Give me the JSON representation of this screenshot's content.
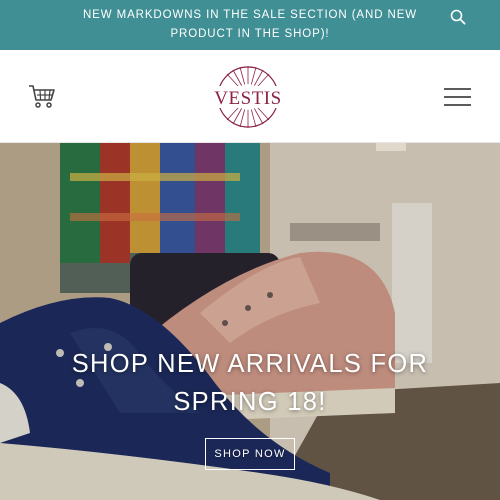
{
  "announcement": {
    "text": "NEW MARKDOWNS IN THE SALE SECTION (AND NEW PRODUCT IN THE SHOP)!",
    "background": "#3f8f95",
    "search_icon": "search-icon"
  },
  "header": {
    "logo_text": "VESTIS",
    "brand_color": "#8b2342",
    "cart_icon": "shopping-cart-icon",
    "menu_icon": "hamburger-menu-icon"
  },
  "hero": {
    "heading": "SHOP NEW ARRIVALS FOR SPRING 18!",
    "button_label": "SHOP NOW"
  }
}
